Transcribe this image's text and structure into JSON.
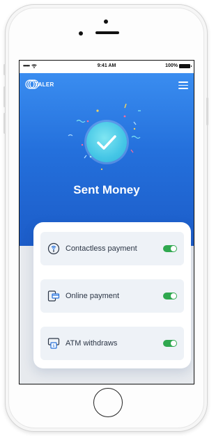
{
  "status_bar": {
    "signal": "•••••",
    "time": "9:41 AM",
    "battery_percent": "100%"
  },
  "header": {
    "logo_text": "TALER",
    "menu_icon": "hamburger-menu-icon"
  },
  "hero": {
    "icon": "checkmark-circle-icon",
    "title": "Sent Money"
  },
  "options": [
    {
      "icon": "contactless-icon",
      "label": "Contactless payment",
      "enabled": true
    },
    {
      "icon": "device-payment-icon",
      "label": "Online payment",
      "enabled": true
    },
    {
      "icon": "atm-icon",
      "label": "ATM withdraws",
      "enabled": true
    }
  ],
  "colors": {
    "accent_blue": "#2470dc",
    "toggle_on": "#2fa84f",
    "check_circle": "#45c6e6"
  }
}
